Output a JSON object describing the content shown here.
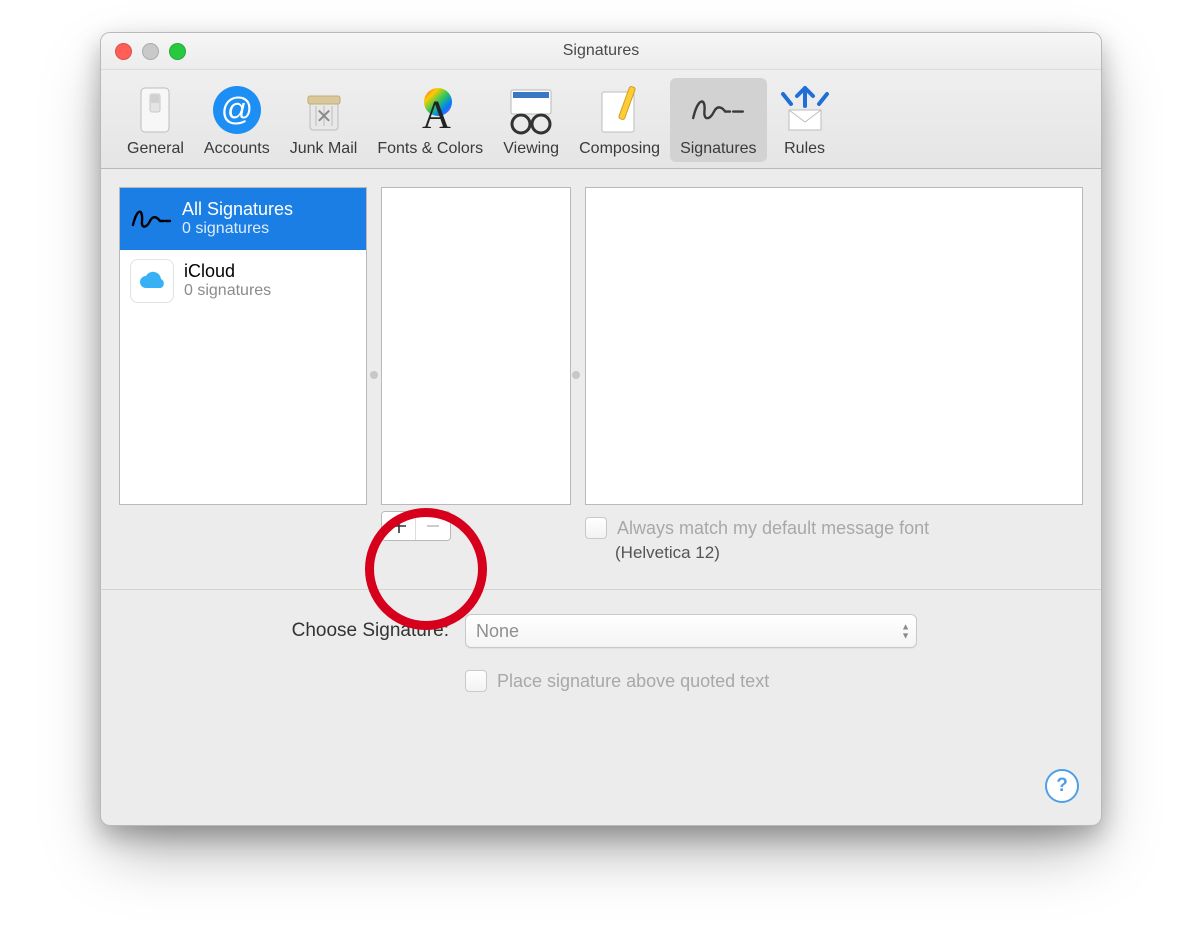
{
  "window": {
    "title": "Signatures"
  },
  "toolbar": {
    "items": [
      {
        "id": "general",
        "label": "General"
      },
      {
        "id": "accounts",
        "label": "Accounts"
      },
      {
        "id": "junk",
        "label": "Junk Mail"
      },
      {
        "id": "fonts",
        "label": "Fonts & Colors"
      },
      {
        "id": "viewing",
        "label": "Viewing"
      },
      {
        "id": "composing",
        "label": "Composing"
      },
      {
        "id": "signatures",
        "label": "Signatures",
        "selected": true
      },
      {
        "id": "rules",
        "label": "Rules"
      }
    ]
  },
  "accounts": {
    "items": [
      {
        "id": "all",
        "name": "All Signatures",
        "sub": "0 signatures",
        "selected": true
      },
      {
        "id": "icloud",
        "name": "iCloud",
        "sub": "0 signatures"
      }
    ]
  },
  "match_font": {
    "label": "Always match my default message font",
    "note": "(Helvetica 12)",
    "checked": false
  },
  "choose": {
    "label": "Choose Signature:",
    "value": "None"
  },
  "place_above": {
    "label": "Place signature above quoted text",
    "checked": false
  },
  "buttons": {
    "add_aria": "Add signature",
    "remove_aria": "Remove signature"
  }
}
